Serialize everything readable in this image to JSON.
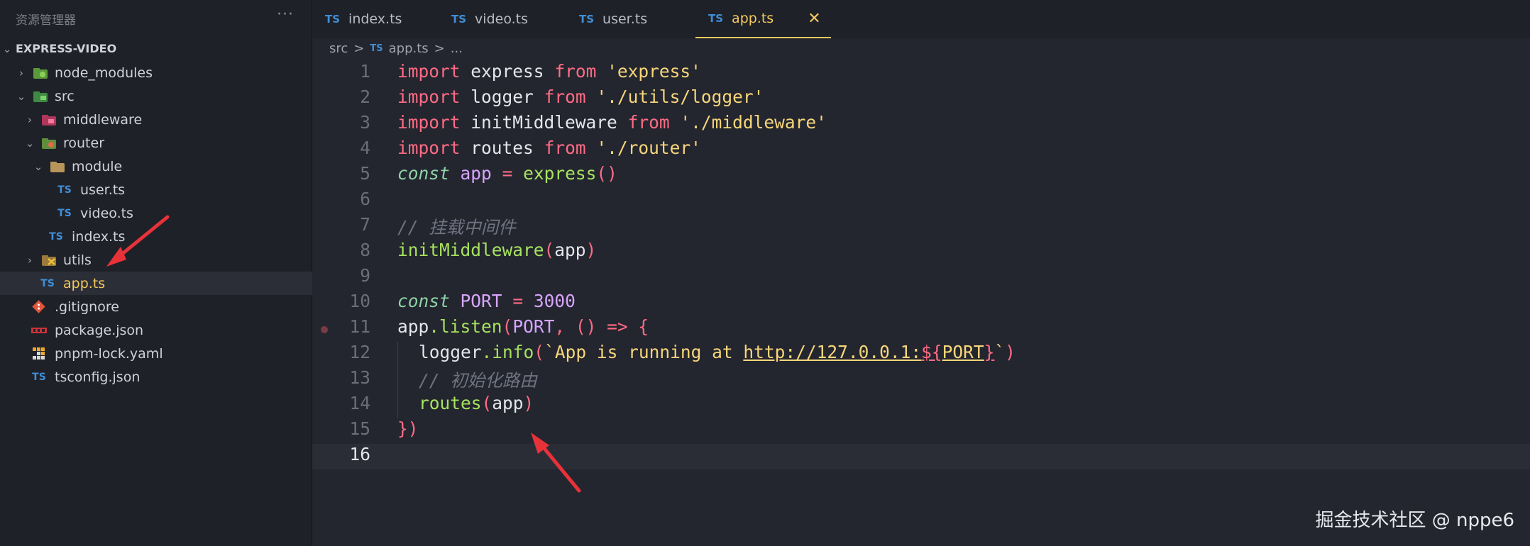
{
  "sidebar": {
    "title": "资源管理器",
    "more": "···",
    "project": "EXPRESS-VIDEO",
    "items": [
      {
        "label": "node_modules",
        "icon": "node-modules-folder-icon",
        "chevron": "›"
      },
      {
        "label": "src",
        "icon": "src-folder-icon",
        "chevron": "⌄"
      },
      {
        "label": "middleware",
        "icon": "middleware-folder-icon",
        "chevron": "›"
      },
      {
        "label": "router",
        "icon": "router-folder-icon",
        "chevron": "⌄"
      },
      {
        "label": "module",
        "icon": "folder-open-icon",
        "chevron": "⌄"
      },
      {
        "label": "user.ts",
        "icon": "ts-file-icon",
        "icon_text": "TS"
      },
      {
        "label": "video.ts",
        "icon": "ts-file-icon",
        "icon_text": "TS"
      },
      {
        "label": "index.ts",
        "icon": "ts-file-icon",
        "icon_text": "TS"
      },
      {
        "label": "utils",
        "icon": "utils-folder-icon",
        "chevron": "›"
      },
      {
        "label": "app.ts",
        "icon": "ts-file-icon",
        "icon_text": "TS"
      },
      {
        "label": ".gitignore",
        "icon": "git-icon"
      },
      {
        "label": "package.json",
        "icon": "npm-icon"
      },
      {
        "label": "pnpm-lock.yaml",
        "icon": "pnpm-icon"
      },
      {
        "label": "tsconfig.json",
        "icon": "tsconfig-icon",
        "icon_text": "TS"
      }
    ]
  },
  "tabs": [
    {
      "label": "index.ts",
      "icon_text": "TS"
    },
    {
      "label": "video.ts",
      "icon_text": "TS"
    },
    {
      "label": "user.ts",
      "icon_text": "TS"
    },
    {
      "label": "app.ts",
      "icon_text": "TS",
      "close": "✕"
    }
  ],
  "breadcrumb": {
    "folder": "src",
    "sep": ">",
    "icon_text": "TS",
    "file": "app.ts",
    "more": "..."
  },
  "code_lines": [
    {
      "n": "1"
    },
    {
      "n": "2"
    },
    {
      "n": "3"
    },
    {
      "n": "4"
    },
    {
      "n": "5"
    },
    {
      "n": "6"
    },
    {
      "n": "7"
    },
    {
      "n": "8"
    },
    {
      "n": "9"
    },
    {
      "n": "10"
    },
    {
      "n": "11"
    },
    {
      "n": "12"
    },
    {
      "n": "13"
    },
    {
      "n": "14"
    },
    {
      "n": "15"
    },
    {
      "n": "16"
    }
  ],
  "code": {
    "import": "import",
    "from": "from",
    "express": "express",
    "express_str": "'express'",
    "logger": "logger",
    "logger_str": "'./utils/logger'",
    "initMiddleware": "initMiddleware",
    "middleware_str": "'./middleware'",
    "routes": "routes",
    "router_str": "'./router'",
    "const": "const",
    "app": "app",
    "eq": "=",
    "call_empty": "()",
    "comment1": "// 挂载中间件",
    "lparen": "(",
    "rparen": ")",
    "port": "PORT",
    "port_value": "3000",
    "listen": "listen",
    "dot": ".",
    "comma_arrow": ", () => {",
    "info": "info",
    "tpl_start": "`App is running at ",
    "url": "http://127.0.0.1:",
    "tpl_open": "${",
    "tpl_close": "}",
    "tpl_end": "`",
    "comment2": "// 初始化路由",
    "close_brace": "})"
  },
  "watermark": "掘金技术社区 @ nppe6",
  "colors": {
    "accent": "#f4c95d",
    "arrow": "#e8323a",
    "ts_blue": "#3f8ed8"
  }
}
